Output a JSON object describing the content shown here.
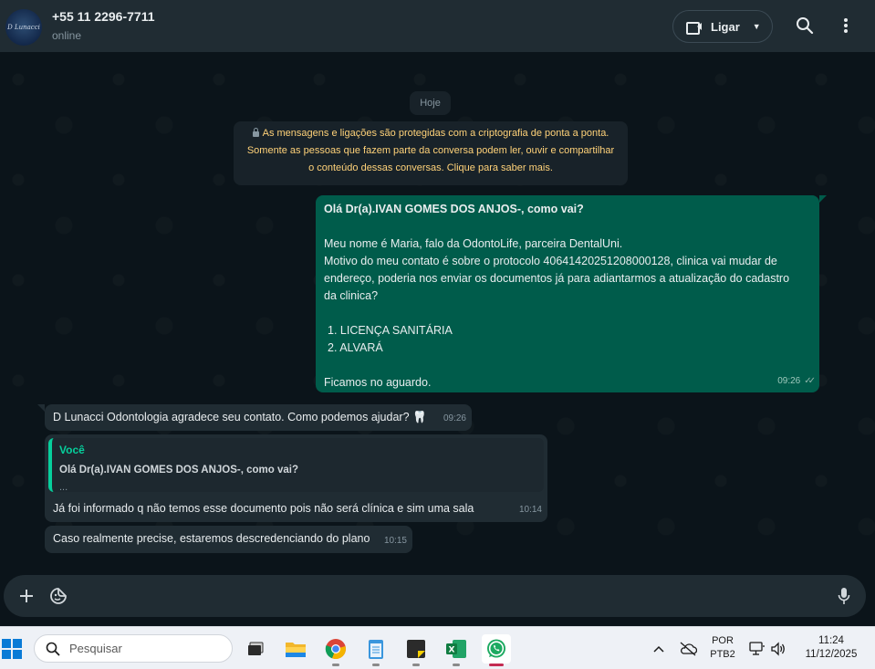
{
  "header": {
    "avatar_text": "D Lunacci",
    "contact_name": "+55 11 2296-7711",
    "status": "online",
    "call_label": "Ligar"
  },
  "chat": {
    "date_pill": "Hoje",
    "encryption_notice": {
      "line1": "As mensagens e ligações são protegidas com a criptografia de ponta a ponta.",
      "line2": "Somente as pessoas que fazem parte da conversa podem ler, ouvir e compartilhar",
      "line3": "o conteúdo dessas conversas. Clique para saber mais."
    },
    "outgoing": {
      "greeting": "Olá Dr(a).IVAN GOMES DOS ANJOS-, como vai?",
      "line1": "Meu nome é Maria, falo da OdontoLife, parceira DentalUni.",
      "line2": "Motivo do meu contato é sobre o protocolo 4064142025120800012​8, clinica vai mudar de",
      "line3": "endereço, poderia nos enviar os documentos já para adiantarmos a atualização do cadastro",
      "line4": "da clinica?",
      "item1": "1.  LICENÇA SANITÁRIA",
      "item2": "2.  ALVARÁ",
      "closing": "Ficamos no aguardo.",
      "time": "09:26"
    },
    "incoming": [
      {
        "text": "D Lunacci Odontologia agradece seu contato. Como podemos ajudar? 🦷",
        "time": "09:26"
      },
      {
        "quote_author": "Você",
        "quote_text": "Olá Dr(a).IVAN GOMES DOS ANJOS-, como vai?",
        "quote_more": "...",
        "text": "Já foi informado q não temos esse documento pois não será clínica e sim uma sala",
        "time": "10:14"
      },
      {
        "text": "Caso realmente precise, estaremos descredenciando do plano",
        "time": "10:15"
      }
    ]
  },
  "taskbar": {
    "search_placeholder": "Pesquisar",
    "lang_line1": "POR",
    "lang_line2": "PTB2",
    "time": "11:24",
    "date": "11/12/2025"
  },
  "colors": {
    "outgoing_bubble": "#005c4b",
    "incoming_bubble": "#202c33",
    "header": "#202c33",
    "chat_bg": "#0b141a",
    "accent": "#06cf9c",
    "notice_text": "#ffd279"
  },
  "icons": [
    "video-icon",
    "search-icon",
    "menu-icon",
    "plus-icon",
    "sticker-icon",
    "mic-icon",
    "windows-start-icon"
  ]
}
